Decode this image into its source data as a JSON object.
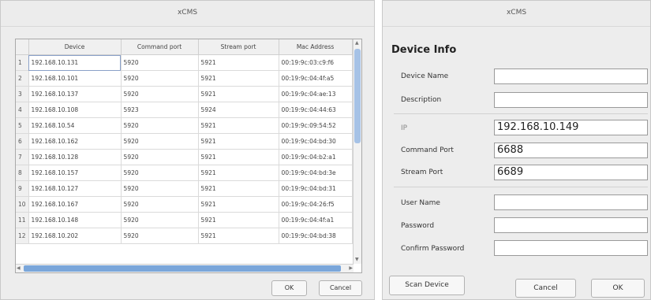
{
  "left_window": {
    "title": "xCMS",
    "columns": [
      "Device",
      "Command port",
      "Stream port",
      "Mac Address"
    ],
    "rows": [
      {
        "n": "1",
        "device": "192.168.10.131",
        "cmd": "5920",
        "stream": "5921",
        "mac": "00:19:9c:03:c9:f6"
      },
      {
        "n": "2",
        "device": "192.168.10.101",
        "cmd": "5920",
        "stream": "5921",
        "mac": "00:19:9c:04:4f:a5"
      },
      {
        "n": "3",
        "device": "192.168.10.137",
        "cmd": "5920",
        "stream": "5921",
        "mac": "00:19:9c:04:ae:13"
      },
      {
        "n": "4",
        "device": "192.168.10.108",
        "cmd": "5923",
        "stream": "5924",
        "mac": "00:19:9c:04:44:63"
      },
      {
        "n": "5",
        "device": "192.168.10.54",
        "cmd": "5920",
        "stream": "5921",
        "mac": "00:19:9c:09:54:52"
      },
      {
        "n": "6",
        "device": "192.168.10.162",
        "cmd": "5920",
        "stream": "5921",
        "mac": "00:19:9c:04:bd:30"
      },
      {
        "n": "7",
        "device": "192.168.10.128",
        "cmd": "5920",
        "stream": "5921",
        "mac": "00:19:9c:04:b2:a1"
      },
      {
        "n": "8",
        "device": "192.168.10.157",
        "cmd": "5920",
        "stream": "5921",
        "mac": "00:19:9c:04:bd:3e"
      },
      {
        "n": "9",
        "device": "192.168.10.127",
        "cmd": "5920",
        "stream": "5921",
        "mac": "00:19:9c:04:bd:31"
      },
      {
        "n": "10",
        "device": "192.168.10.167",
        "cmd": "5920",
        "stream": "5921",
        "mac": "00:19:9c:04:26:f5"
      },
      {
        "n": "11",
        "device": "192.168.10.148",
        "cmd": "5920",
        "stream": "5921",
        "mac": "00:19:9c:04:4f:a1"
      },
      {
        "n": "12",
        "device": "192.168.10.202",
        "cmd": "5920",
        "stream": "5921",
        "mac": "00:19:9c:04:bd:38"
      }
    ],
    "ok_label": "OK",
    "cancel_label": "Cancel"
  },
  "right_window": {
    "title": "xCMS",
    "section_title": "Device Info",
    "fields": {
      "device_name": {
        "label": "Device Name",
        "value": ""
      },
      "description": {
        "label": "Description",
        "value": ""
      },
      "ip": {
        "label": "IP",
        "value": "192.168.10.149"
      },
      "command_port": {
        "label": "Command Port",
        "value": "6688"
      },
      "stream_port": {
        "label": "Stream Port",
        "value": "6689"
      },
      "user_name": {
        "label": "User Name",
        "value": ""
      },
      "password": {
        "label": "Password",
        "value": ""
      },
      "confirm_password": {
        "label": "Confirm Password",
        "value": ""
      }
    },
    "scan_label": "Scan Device",
    "cancel_label": "Cancel",
    "ok_label": "OK"
  },
  "icons": {
    "scroll_up": "up-arrow-icon",
    "scroll_down": "down-arrow-icon",
    "scroll_left": "left-arrow-icon",
    "scroll_right": "right-arrow-icon"
  },
  "colors": {
    "window_bg": "#ededed",
    "scroll_thumb": "#7aa6da",
    "selection_outline": "#8aa0c8"
  }
}
